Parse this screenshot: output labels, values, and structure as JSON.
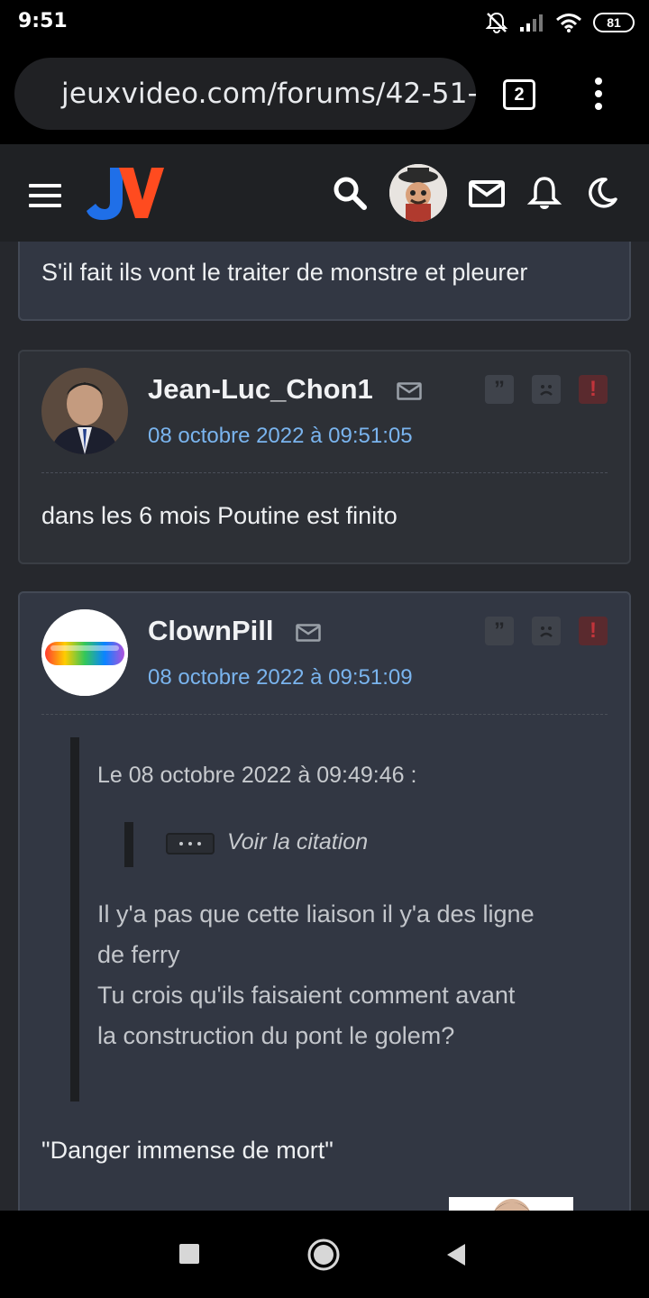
{
  "status_bar": {
    "time": "9:51",
    "battery": "81"
  },
  "browser": {
    "url": "jeuxvideo.com/forums/42-51-",
    "tab_count": "2"
  },
  "site": {
    "brand_colors": {
      "j": "#1f6fe8",
      "v": "#ff4b1f"
    }
  },
  "posts": [
    {
      "text": "S'il fait ils vont le traiter de monstre et pleurer"
    },
    {
      "author": "Jean-Luc_Chon1",
      "date": "08 octobre 2022 à 09:51:05",
      "text": "dans les 6 mois Poutine est finito"
    },
    {
      "author": "ClownPill",
      "date": "08 octobre 2022 à 09:51:09",
      "quote": {
        "header": "Le 08 octobre 2022 à 09:49:46 :",
        "nested_label": "Voir la citation",
        "lines": [
          "Il y'a pas que cette liaison il y'a des ligne",
          "de ferry",
          "Tu crois qu'ils faisaient comment avant",
          "la construction du pont le golem?"
        ]
      },
      "text": "\"Danger immense de mort\""
    }
  ],
  "icons": {
    "quote": "quote-icon",
    "sad": "sad-face-icon",
    "alert": "alert-icon",
    "mail": "mail-icon"
  }
}
